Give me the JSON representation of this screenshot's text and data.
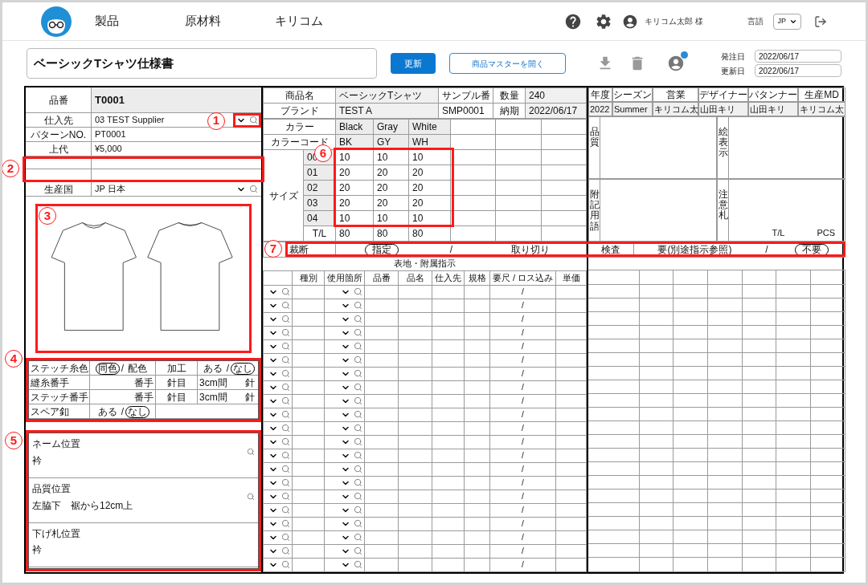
{
  "header": {
    "nav": [
      {
        "label": "製品"
      },
      {
        "label": "原材料"
      },
      {
        "label": "キリコム"
      }
    ],
    "user": "キリコム太郎 様",
    "language_label": "言語",
    "language": "JP"
  },
  "toolbar": {
    "title": "ベーシックTシャツ仕様書",
    "update_button": "更新",
    "master_button": "商品マスターを開く",
    "dates": [
      {
        "label": "発注日",
        "value": "2022/06/17"
      },
      {
        "label": "更新日",
        "value": "2022/06/17"
      }
    ]
  },
  "product": {
    "fields": [
      {
        "kind": "title",
        "label": "品番",
        "value": "T0001"
      },
      {
        "kind": "select",
        "label": "仕入先",
        "value": "03 TEST Supplier"
      },
      {
        "kind": "text",
        "label": "パターンNO.",
        "value": "PT0001"
      },
      {
        "kind": "text",
        "label": "上代",
        "value": "¥5,000"
      },
      {
        "kind": "blank"
      },
      {
        "kind": "blank"
      },
      {
        "kind": "select",
        "label": "生産国",
        "value": "JP 日本"
      }
    ]
  },
  "stitch": {
    "rows": [
      {
        "cells": [
          {
            "kind": "label",
            "text": "ステッチ糸色"
          },
          {
            "kind": "choice",
            "separator": "/",
            "options": [
              {
                "label": "同色",
                "selected": true
              },
              {
                "label": "配色",
                "selected": false
              }
            ]
          },
          {
            "kind": "center",
            "text": "加工"
          },
          {
            "kind": "choice",
            "separator": "/",
            "options": [
              {
                "label": "ある",
                "selected": false
              },
              {
                "label": "なし",
                "selected": true
              }
            ]
          }
        ]
      },
      {
        "cells": [
          {
            "kind": "label",
            "text": "縫糸番手"
          },
          {
            "kind": "right",
            "text": "番手"
          },
          {
            "kind": "center",
            "text": "針目"
          },
          {
            "kind": "split",
            "left": "3cm間",
            "right": "針"
          }
        ]
      },
      {
        "cells": [
          {
            "kind": "label",
            "text": "ステッチ番手"
          },
          {
            "kind": "right",
            "text": "番手"
          },
          {
            "kind": "center",
            "text": "針目"
          },
          {
            "kind": "split",
            "left": "3cm間",
            "right": "針"
          }
        ]
      },
      {
        "cells": [
          {
            "kind": "label",
            "text": "スペア釦"
          },
          {
            "kind": "choice",
            "separator": "/",
            "options": [
              {
                "label": "ある",
                "selected": false
              },
              {
                "label": "なし",
                "selected": true
              }
            ]
          },
          {
            "kind": "span"
          }
        ]
      }
    ]
  },
  "positions": [
    {
      "label": "ネーム位置",
      "value": "衿",
      "searchable": true
    },
    {
      "label": "品質位置",
      "value": "左脇下　裾から12cm上",
      "searchable": true
    },
    {
      "label": "下げ札位置",
      "value": "衿",
      "searchable": false
    }
  ],
  "info_rows": [
    {
      "cells": [
        "商品名",
        "ベーシックTシャツ",
        "サンプル番",
        "数量",
        "240"
      ]
    },
    {
      "cells": [
        "ブランド",
        "TEST A",
        "SMP0001",
        "納期",
        "2022/06/17"
      ]
    }
  ],
  "colors": {
    "label": "カラー",
    "names": [
      "Black",
      "Gray",
      "White"
    ],
    "code_label": "カラーコード",
    "codes": [
      "BK",
      "GY",
      "WH"
    ]
  },
  "sizes": {
    "label": "サイズ",
    "rows": [
      {
        "size": "00",
        "quantities": [
          "10",
          "10",
          "10"
        ]
      },
      {
        "size": "01",
        "quantities": [
          "20",
          "20",
          "20"
        ]
      },
      {
        "size": "02",
        "quantities": [
          "20",
          "20",
          "20"
        ]
      },
      {
        "size": "03",
        "quantities": [
          "20",
          "20",
          "20"
        ]
      },
      {
        "size": "04",
        "quantities": [
          "10",
          "10",
          "10"
        ]
      }
    ],
    "total_label": "T/L",
    "totals": [
      "80",
      "80",
      "80"
    ]
  },
  "staff": {
    "headers": [
      "年度",
      "シーズン",
      "営業",
      "デザイナー",
      "パタンナー",
      "生産MD"
    ],
    "values": [
      "2022",
      "Summer",
      "キリコム太",
      "山田キリ",
      "山田キリ",
      "キリコム太"
    ]
  },
  "notes": [
    {
      "label": "品質"
    },
    {
      "label": "絵表示"
    },
    {
      "label": "附記用語"
    },
    {
      "label": "注意札",
      "footer": [
        "T/L",
        "PCS"
      ]
    }
  ],
  "cutting": {
    "label": "裁断",
    "separator": "/",
    "options": [
      {
        "label": "指定",
        "selected": true
      },
      {
        "label": "取り切り",
        "selected": false
      }
    ]
  },
  "inspection": {
    "label": "検査",
    "separator": "/",
    "options": [
      {
        "label": "要(別途指示参照)",
        "selected": false
      },
      {
        "label": "不要",
        "selected": true
      }
    ]
  },
  "materials": {
    "title": "表地・附属指示",
    "columns": [
      "種別",
      "使用箇所",
      "品番",
      "品名",
      "仕入先",
      "規格",
      "要尺 / ロス込み",
      "単価"
    ],
    "rows": [
      {
        "yield": "/"
      },
      {
        "yield": "/"
      },
      {
        "yield": "/"
      },
      {
        "yield": "/"
      },
      {
        "yield": "/"
      },
      {
        "yield": "/"
      },
      {
        "yield": "/"
      },
      {
        "yield": "/"
      },
      {
        "yield": "/"
      },
      {
        "yield": "/"
      },
      {
        "yield": "/"
      },
      {
        "yield": "/"
      },
      {
        "yield": "/"
      },
      {
        "yield": "/"
      },
      {
        "yield": "/"
      },
      {
        "yield": "/"
      },
      {
        "yield": "/"
      },
      {
        "yield": "/"
      },
      {
        "yield": "/"
      },
      {
        "yield": "/"
      },
      {
        "yield": "/"
      }
    ]
  },
  "callouts": [
    {
      "number": "1"
    },
    {
      "number": "2"
    },
    {
      "number": "3"
    },
    {
      "number": "4"
    },
    {
      "number": "5"
    },
    {
      "number": "6"
    },
    {
      "number": "7"
    }
  ]
}
